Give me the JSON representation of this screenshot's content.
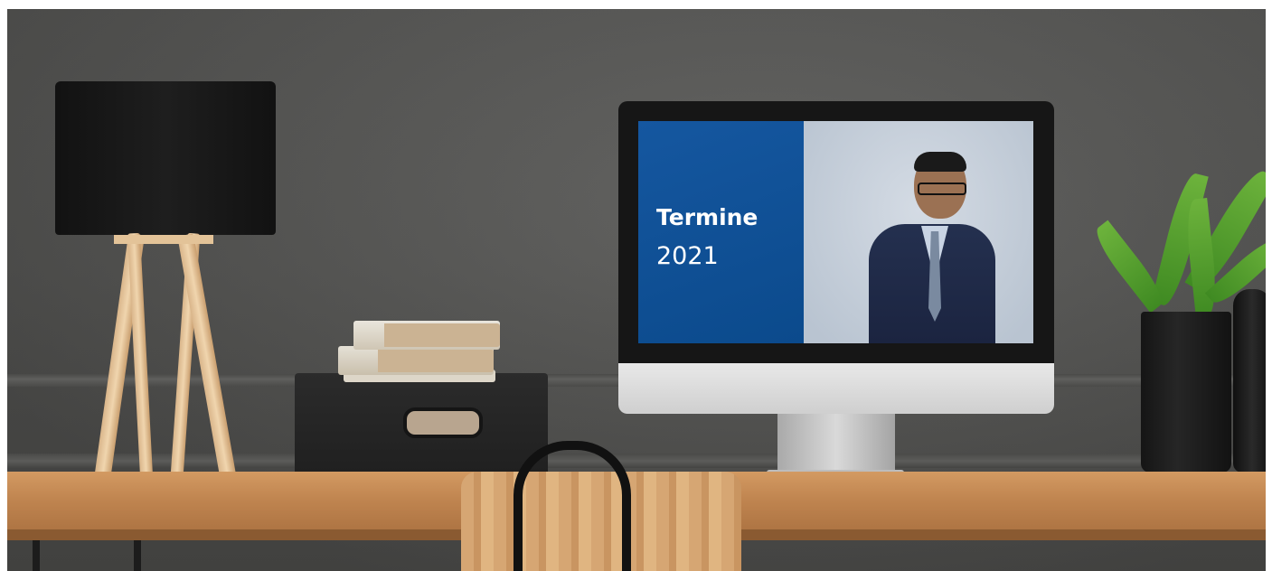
{
  "screen": {
    "title": "Termine",
    "year": "2021"
  },
  "colors": {
    "screen_panel": "#0b4a8c",
    "wall": "#585856",
    "desk": "#c08550"
  }
}
